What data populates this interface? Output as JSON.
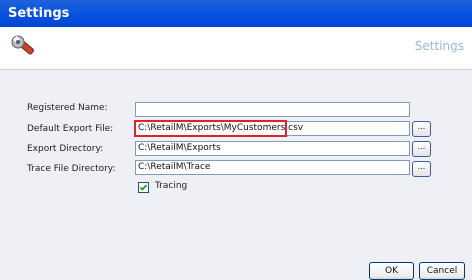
{
  "window": {
    "title": "Settings"
  },
  "header": {
    "title": "Settings",
    "icon": "wrench-icon"
  },
  "form": {
    "registered_name": {
      "label": "Registered Name:",
      "value": ""
    },
    "default_export_file": {
      "label": "Default Export File:",
      "value": "C:\\RetailM\\Exports\\MyCustomers.csv",
      "browse_label": "..."
    },
    "export_directory": {
      "label": "Export Directory:",
      "value": "C:\\RetailM\\Exports",
      "browse_label": "..."
    },
    "trace_file_directory": {
      "label": "Trace File Directory:",
      "value": "C:\\RetailM\\Trace",
      "browse_label": "..."
    },
    "tracing": {
      "label": "Tracing",
      "checked": true
    }
  },
  "buttons": {
    "ok_label": "OK",
    "cancel_label": "Cancel"
  },
  "colors": {
    "titlebar": "#0a54e0",
    "header_title": "#9ab8df",
    "highlight": "#e0202a",
    "content_bg": "#eef0f6"
  }
}
